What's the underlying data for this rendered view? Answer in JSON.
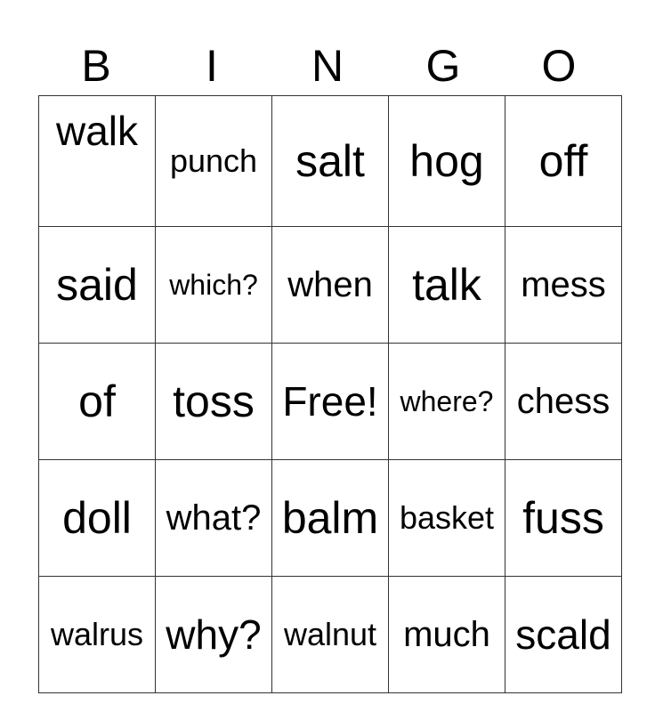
{
  "header": [
    "B",
    "I",
    "N",
    "G",
    "O"
  ],
  "rows": [
    [
      "walk",
      "punch",
      "salt",
      "hog",
      "off"
    ],
    [
      "said",
      "which?",
      "when",
      "talk",
      "mess"
    ],
    [
      "of",
      "toss",
      "Free!",
      "where?",
      "chess"
    ],
    [
      "doll",
      "what?",
      "balm",
      "basket",
      "fuss"
    ],
    [
      "walrus",
      "why?",
      "walnut",
      "much",
      "scald"
    ]
  ]
}
